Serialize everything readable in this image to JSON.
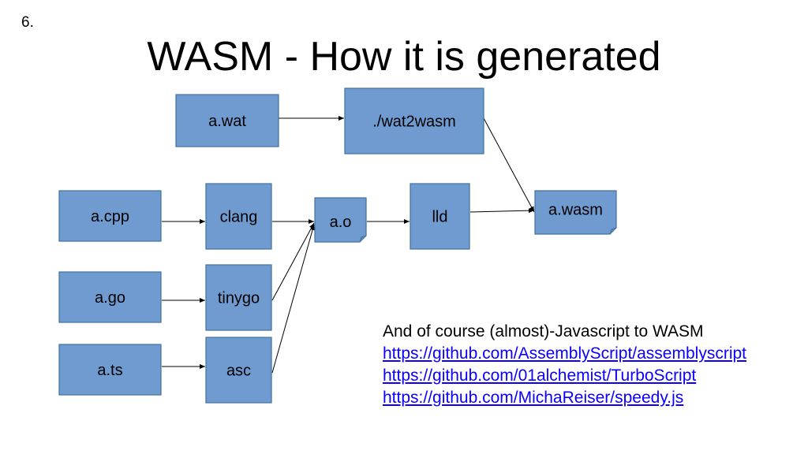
{
  "slide": {
    "number": "6.",
    "title": "WASM - How it is generated"
  },
  "colors": {
    "box_fill": "#6f9bd1",
    "box_border": "#41719c",
    "link": "#0b00ff"
  },
  "diagram": {
    "nodes": [
      {
        "id": "a_wat",
        "label": "a.wat",
        "shape": "rect"
      },
      {
        "id": "wat2wasm",
        "label": "./wat2wasm",
        "shape": "rect"
      },
      {
        "id": "a_cpp",
        "label": "a.cpp",
        "shape": "rect"
      },
      {
        "id": "clang",
        "label": "clang",
        "shape": "rect"
      },
      {
        "id": "a_o",
        "label": "a.o",
        "shape": "note"
      },
      {
        "id": "lld",
        "label": "lld",
        "shape": "rect"
      },
      {
        "id": "a_wasm",
        "label": "a.wasm",
        "shape": "note"
      },
      {
        "id": "a_go",
        "label": "a.go",
        "shape": "rect"
      },
      {
        "id": "tinygo",
        "label": "tinygo",
        "shape": "rect"
      },
      {
        "id": "a_ts",
        "label": "a.ts",
        "shape": "rect"
      },
      {
        "id": "asc",
        "label": "asc",
        "shape": "rect"
      }
    ],
    "edges": [
      {
        "from": "a_wat",
        "to": "wat2wasm"
      },
      {
        "from": "wat2wasm",
        "to": "a_wasm"
      },
      {
        "from": "a_cpp",
        "to": "clang"
      },
      {
        "from": "clang",
        "to": "a_o"
      },
      {
        "from": "a_o",
        "to": "lld"
      },
      {
        "from": "lld",
        "to": "a_wasm"
      },
      {
        "from": "a_go",
        "to": "tinygo"
      },
      {
        "from": "tinygo",
        "to": "a_o"
      },
      {
        "from": "a_ts",
        "to": "asc"
      },
      {
        "from": "asc",
        "to": "a_o"
      }
    ]
  },
  "notes": {
    "heading": "And of course (almost)-Javascript to WASM",
    "links": [
      "https://github.com/AssemblyScript/assemblyscript",
      "https://github.com/01alchemist/TurboScript",
      "https://github.com/MichaReiser/speedy.js"
    ]
  }
}
